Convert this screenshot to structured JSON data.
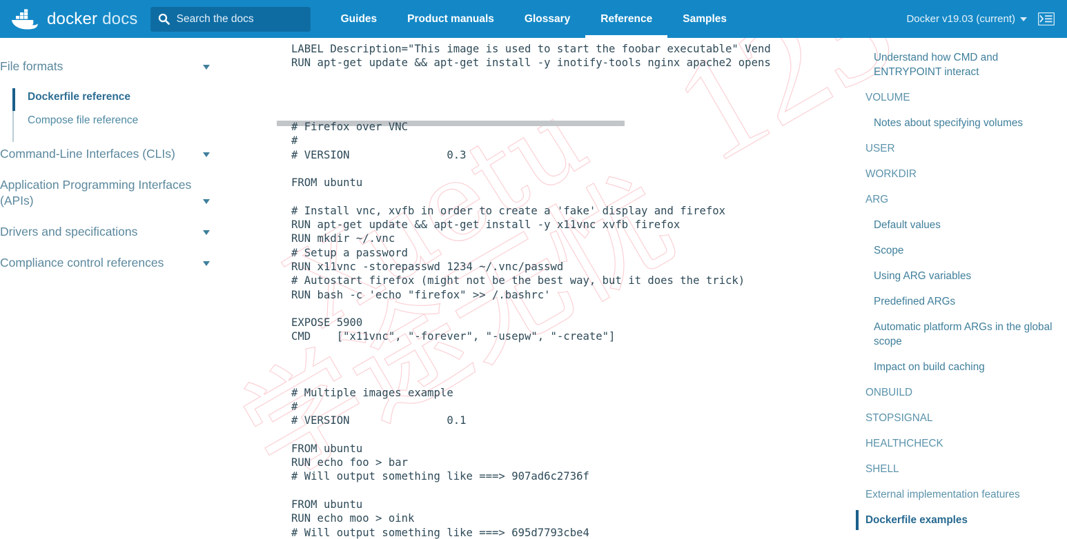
{
  "header": {
    "brand_bold": "docker",
    "brand_light": "docs",
    "logo_icon": "docker-whale-logo",
    "search": {
      "placeholder": "Search the docs",
      "icon": "search-icon"
    },
    "nav": [
      {
        "label": "Guides",
        "active": false
      },
      {
        "label": "Product manuals",
        "active": false
      },
      {
        "label": "Glossary",
        "active": false
      },
      {
        "label": "Reference",
        "active": true
      },
      {
        "label": "Samples",
        "active": false
      }
    ],
    "version_label": "Docker v19.03 (current)",
    "version_caret_icon": "chevron-down-icon",
    "console_icon": "terminal-console-icon",
    "bg_color": "#1488c6",
    "search_bg_color": "#0f6ca3"
  },
  "left_sidebar": {
    "sections": [
      {
        "label": "File formats",
        "caret_icon": "chevron-down-icon"
      },
      {
        "label": "Command-Line Interfaces (CLIs)",
        "caret_icon": "chevron-down-icon"
      },
      {
        "label": "Application Programming Interfaces (APIs)",
        "caret_icon": "chevron-down-icon"
      },
      {
        "label": "Drivers and specifications",
        "caret_icon": "chevron-down-icon"
      },
      {
        "label": "Compliance control references",
        "caret_icon": "chevron-down-icon"
      }
    ],
    "subitems": [
      {
        "label": "Dockerfile reference",
        "active": true
      },
      {
        "label": "Compose file reference",
        "active": false
      }
    ],
    "active_accent_color": "#1a5f8a"
  },
  "main": {
    "code_top": "LABEL Description=\"This image is used to start the foobar executable\" Vend\nRUN apt-get update && apt-get install -y inotify-tools nginx apache2 opens",
    "scrollbar": {
      "orientation": "horizontal",
      "thumb_color": "#c2c6c9"
    },
    "code_body": "# Firefox over VNC\n#\n# VERSION               0.3\n\nFROM ubuntu\n\n# Install vnc, xvfb in order to create a 'fake' display and firefox\nRUN apt-get update && apt-get install -y x11vnc xvfb firefox\nRUN mkdir ~/.vnc\n# Setup a password\nRUN x11vnc -storepasswd 1234 ~/.vnc/passwd\n# Autostart firefox (might not be the best way, but it does the trick)\nRUN bash -c 'echo \"firefox\" >> /.bashrc'\n\nEXPOSE 5900\nCMD    [\"x11vnc\", \"-forever\", \"-usepw\", \"-create\"]\n\n\n\n# Multiple images example\n#\n# VERSION               0.1\n\nFROM ubuntu\nRUN echo foo > bar\n# Will output something like ===> 907ad6c2736f\n\nFROM ubuntu\nRUN echo moo > oink\n# Will output something like ===> 695d7793cbe4"
  },
  "right_toc": {
    "items": [
      {
        "label": "Understand how CMD and ENTRYPOINT interact",
        "level": 2,
        "active": false
      },
      {
        "label": "VOLUME",
        "level": 1,
        "active": false
      },
      {
        "label": "Notes about specifying volumes",
        "level": 2,
        "active": false
      },
      {
        "label": "USER",
        "level": 1,
        "active": false
      },
      {
        "label": "WORKDIR",
        "level": 1,
        "active": false
      },
      {
        "label": "ARG",
        "level": 1,
        "active": false
      },
      {
        "label": "Default values",
        "level": 2,
        "active": false
      },
      {
        "label": "Scope",
        "level": 2,
        "active": false
      },
      {
        "label": "Using ARG variables",
        "level": 2,
        "active": false
      },
      {
        "label": "Predefined ARGs",
        "level": 2,
        "active": false
      },
      {
        "label": "Automatic platform ARGs in the global scope",
        "level": 2,
        "active": false
      },
      {
        "label": "Impact on build caching",
        "level": 2,
        "active": false
      },
      {
        "label": "ONBUILD",
        "level": 1,
        "active": false
      },
      {
        "label": "STOPSIGNAL",
        "level": 1,
        "active": false
      },
      {
        "label": "HEALTHCHECK",
        "level": 1,
        "active": false
      },
      {
        "label": "SHELL",
        "level": 1,
        "active": false
      },
      {
        "label": "External implementation features",
        "level": 1,
        "active": false
      },
      {
        "label": "Dockerfile examples",
        "level": 1,
        "active": true
      }
    ]
  },
  "watermark": {
    "text_1": "123",
    "text_2": "学途无忧",
    "text_3": "Xuetu",
    "color": "#fbc8ce"
  }
}
